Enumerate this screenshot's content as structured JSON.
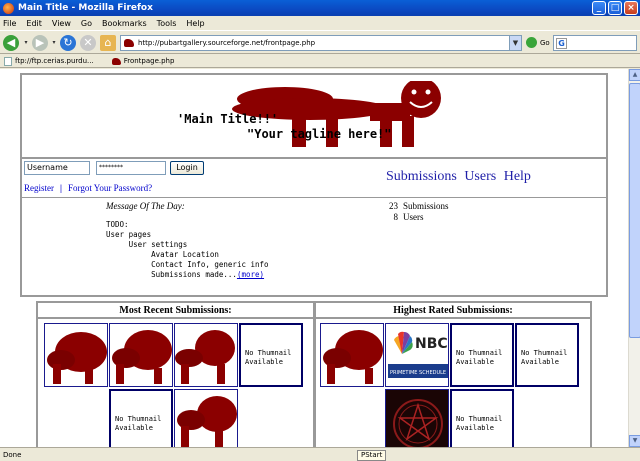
{
  "window": {
    "title": "Main Title - Mozilla Firefox"
  },
  "menu": [
    "File",
    "Edit",
    "View",
    "Go",
    "Bookmarks",
    "Tools",
    "Help"
  ],
  "address": {
    "url": "http://pubartgallery.sourceforge.net/frontpage.php",
    "go_label": "Go"
  },
  "bookmarks": [
    "ftp://ftp.cerias.purdu...",
    "Frontpage.php"
  ],
  "header": {
    "main_title": "'Main Title!!'",
    "tagline": "\"Your tagline here!\""
  },
  "login": {
    "username_value": "Username",
    "password_mask": "********",
    "login_label": "Login",
    "register_label": "Register",
    "separator": "|",
    "forgot_label": "Forgot Your Password?"
  },
  "nav": {
    "submissions": "Submissions",
    "users": "Users",
    "help": "Help"
  },
  "motd": {
    "title": "Message Of The Day:",
    "lines": [
      "TODO:",
      "User pages",
      "     User settings",
      "          Avatar Location",
      "          Contact Info, generic info",
      "          Submissions made..."
    ],
    "more_label": "(more)"
  },
  "stats": [
    {
      "count": "23",
      "label": "Submissions"
    },
    {
      "count": "8",
      "label": "Users"
    }
  ],
  "recent": {
    "heading": "Most Recent Submissions:",
    "no_thumb_line1": "No Thumnail",
    "no_thumb_line2": "Available"
  },
  "rated": {
    "heading": "Highest Rated Submissions:",
    "nbc_text": "NBC",
    "nbc_sub": "PRIMETIME SCHEDULE"
  },
  "status": {
    "text": "Done",
    "pstart": "PStart"
  },
  "colors": {
    "mascot": "#8b0000",
    "link": "#0000cc",
    "nav": "#1f1fa8",
    "titlebar": "#0a4fc7"
  }
}
